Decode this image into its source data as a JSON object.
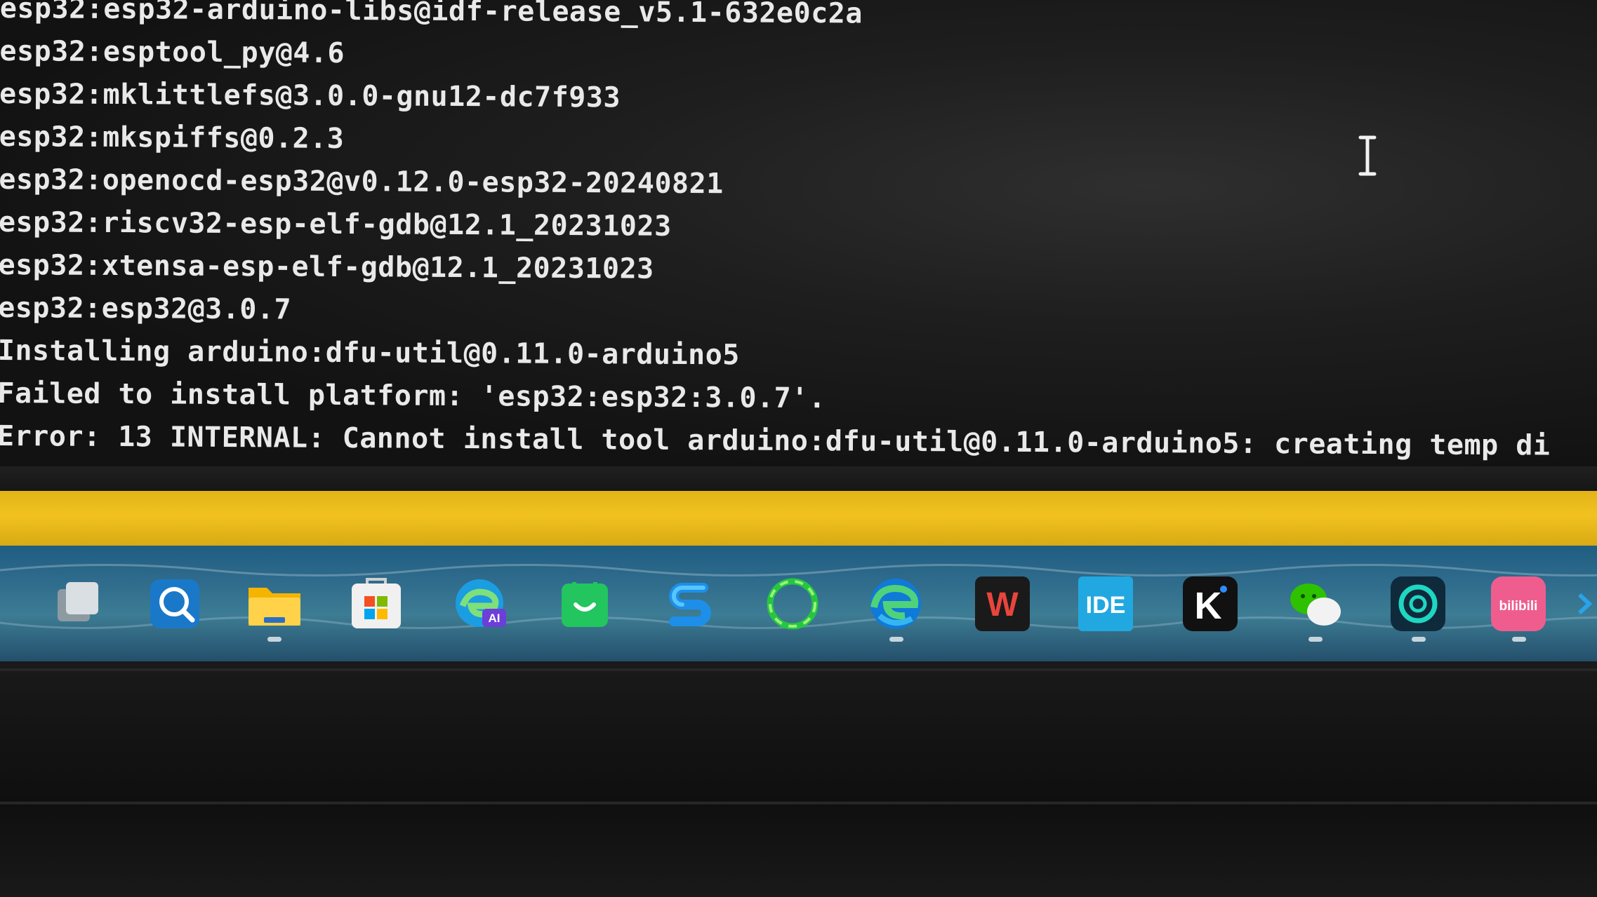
{
  "terminal": {
    "lines": [
      "esp32:esp32-arduino-libs@idf-release_v5.1-632e0c2a",
      "esp32:esptool_py@4.6",
      "esp32:mklittlefs@3.0.0-gnu12-dc7f933",
      "esp32:mkspiffs@0.2.3",
      "esp32:openocd-esp32@v0.12.0-esp32-20240821",
      "esp32:riscv32-esp-elf-gdb@12.1_20231023",
      "esp32:xtensa-esp-elf-gdb@12.1_20231023",
      "esp32:esp32@3.0.7",
      "Installing arduino:dfu-util@0.11.0-arduino5",
      "Failed to install platform: 'esp32:esp32:3.0.7'.",
      "Error: 13 INTERNAL: Cannot install tool arduino:dfu-util@0.11.0-arduino5: creating temp di"
    ],
    "text_color": "#e9e9e9",
    "cursor_icon": "text-cursor-icon"
  },
  "window_bar": {
    "color": "#f1c21f"
  },
  "taskbar": {
    "icons": [
      {
        "name": "task-view-icon",
        "running": false
      },
      {
        "name": "search-icon",
        "running": false
      },
      {
        "name": "file-explorer-icon",
        "running": true
      },
      {
        "name": "microsoft-store-icon",
        "running": false
      },
      {
        "name": "edge-ai-icon",
        "running": false
      },
      {
        "name": "green-app-icon",
        "running": false
      },
      {
        "name": "blue-s-app-icon",
        "running": false
      },
      {
        "name": "green-ring-app-icon",
        "running": false
      },
      {
        "name": "edge-browser-icon",
        "running": true
      },
      {
        "name": "wps-office-icon",
        "running": false
      },
      {
        "name": "ide-icon",
        "running": false
      },
      {
        "name": "k-app-icon",
        "running": false
      },
      {
        "name": "wechat-icon",
        "running": true
      },
      {
        "name": "circle-app-icon",
        "running": true
      },
      {
        "name": "bilibili-icon",
        "running": true
      }
    ],
    "labels": {
      "ide": "IDE",
      "bilibili": "bilibili",
      "ai": "AI",
      "k": "K",
      "w": "W"
    }
  }
}
